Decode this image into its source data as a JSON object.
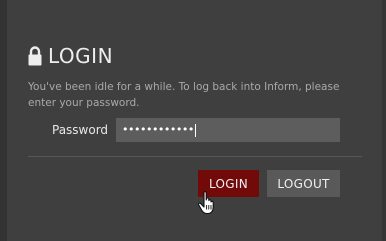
{
  "dialog": {
    "icon": "lock-icon",
    "title": "LOGIN",
    "message": "You've been idle for a while. To log back into Inform, please enter your password.",
    "password_label": "Password",
    "password_masked": "••••••••••••",
    "login_label": "LOGIN",
    "logout_label": "LOGOUT"
  },
  "colors": {
    "background": "#3f3f3f",
    "login_button": "#720a0a",
    "logout_button": "#595959",
    "input_background": "#5d5d5d",
    "message_text": "#a9a9a9"
  },
  "cursor": "hand-pointer-icon"
}
